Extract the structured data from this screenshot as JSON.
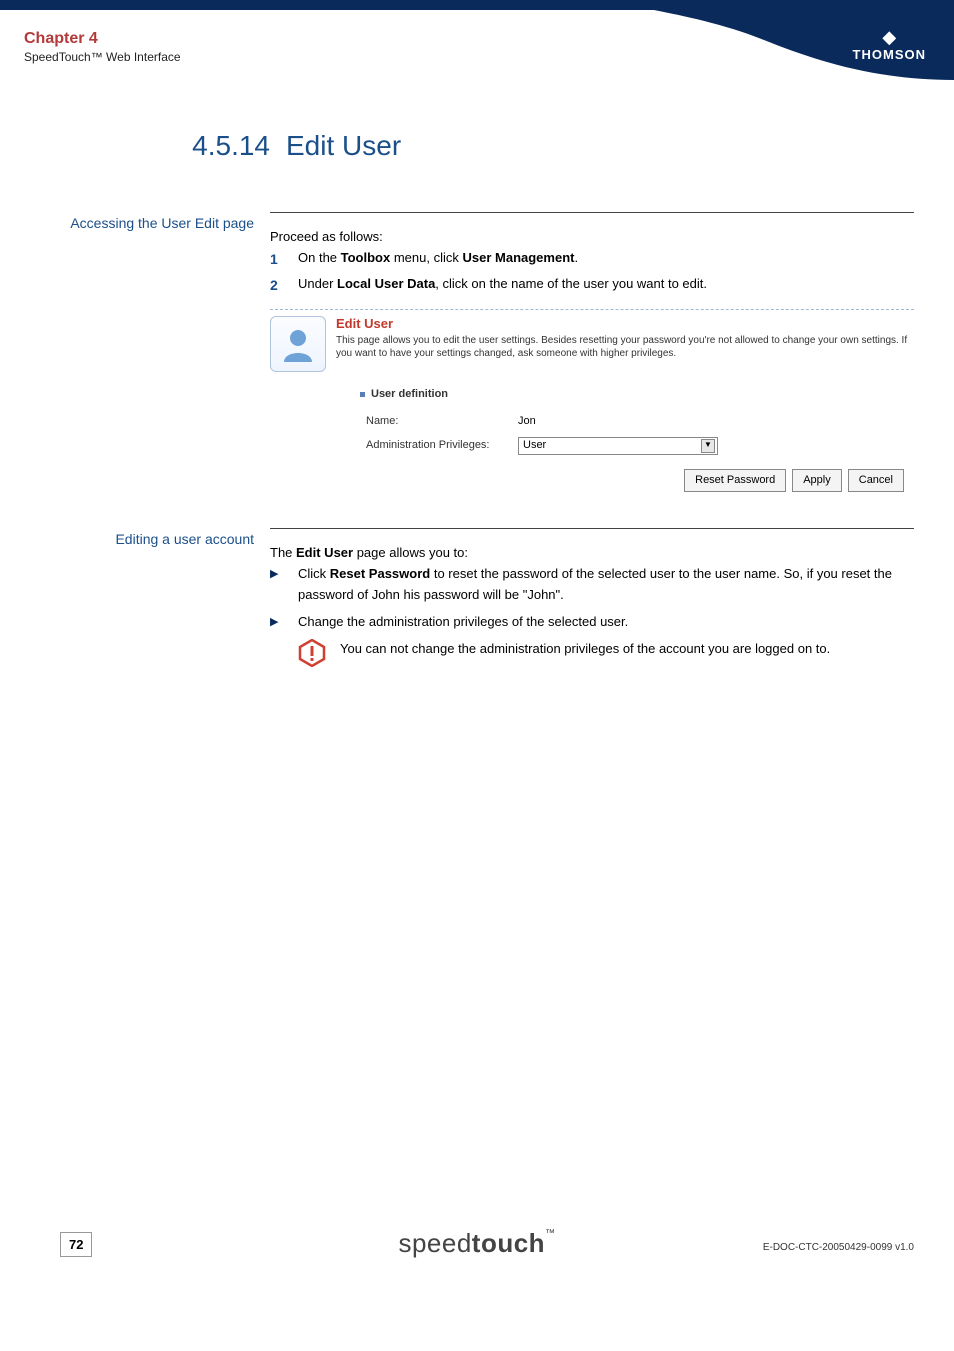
{
  "header": {
    "chapter": "Chapter 4",
    "subtitle": "SpeedTouch™ Web Interface",
    "brand": "THOMSON"
  },
  "section": {
    "number": "4.5.14",
    "title": "Edit User"
  },
  "block1": {
    "aside": "Accessing the User Edit page",
    "intro": "Proceed as follows:",
    "step1_pre": "On the ",
    "step1_b1": "Toolbox",
    "step1_mid": " menu, click ",
    "step1_b2": "User Management",
    "step1_post": ".",
    "step2_pre": "Under ",
    "step2_b1": "Local User Data",
    "step2_post": ", click on the name of the user you want to edit."
  },
  "shot": {
    "title": "Edit User",
    "desc": "This page allows you to edit the user settings. Besides resetting your password you're not allowed to change your own settings. If you want to have your settings changed, ask someone with higher privileges.",
    "section": "User definition",
    "name_label": "Name:",
    "name_value": "Jon",
    "priv_label": "Administration Privileges:",
    "priv_value": "User",
    "btn_reset": "Reset Password",
    "btn_apply": "Apply",
    "btn_cancel": "Cancel"
  },
  "block2": {
    "aside": "Editing a user account",
    "intro_pre": "The ",
    "intro_b": "Edit User",
    "intro_post": " page allows you to:",
    "li1_pre": "Click ",
    "li1_b": "Reset Password",
    "li1_post": " to reset the password of the selected user to the user name. So, if you reset the password of John his password will be \"John\".",
    "li2": "Change the administration privileges of the selected user.",
    "callout": "You can not change the administration privileges of the account you are logged on to."
  },
  "footer": {
    "page": "72",
    "logo_light": "speed",
    "logo_bold": "touch",
    "tm": "™",
    "doccode": "E-DOC-CTC-20050429-0099 v1.0"
  }
}
